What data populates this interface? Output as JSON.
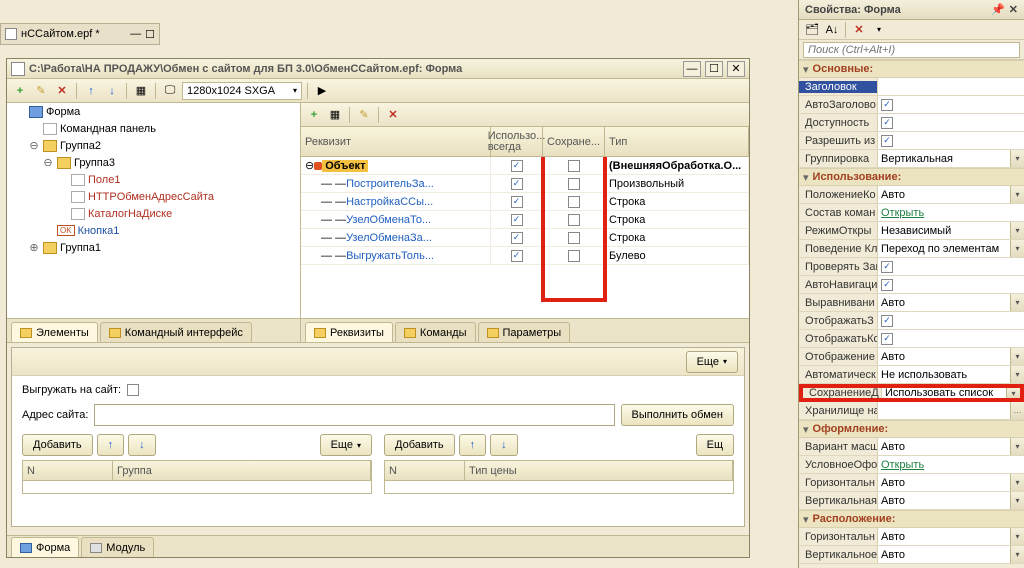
{
  "bg_tab": {
    "title": "нССайтом.epf *"
  },
  "window": {
    "title": "С:\\Работа\\НА ПРОДАЖУ\\Обмен с сайтом для БП 3.0\\ОбменССайтом.epf: Форма",
    "resolution": "1280x1024 SXGA"
  },
  "tree": {
    "items": [
      {
        "label": "Форма",
        "icon": "form",
        "indent": 0,
        "tw": ""
      },
      {
        "label": "Командная панель",
        "icon": "item",
        "indent": 1,
        "tw": ""
      },
      {
        "label": "Группа2",
        "icon": "folder",
        "indent": 1,
        "tw": "⊖"
      },
      {
        "label": "Группа3",
        "icon": "folder",
        "indent": 2,
        "tw": "⊖"
      },
      {
        "label": "Поле1",
        "icon": "item",
        "indent": 3,
        "tw": "",
        "red": true
      },
      {
        "label": "HTTPОбменАдресСайта",
        "icon": "item",
        "indent": 3,
        "tw": "",
        "red": true
      },
      {
        "label": "КаталогНаДиске",
        "icon": "item",
        "indent": 3,
        "tw": "",
        "red": true
      },
      {
        "label": "Кнопка1",
        "icon": "item",
        "indent": 2,
        "tw": "",
        "blue": true,
        "ok": true
      },
      {
        "label": "Группа1",
        "icon": "folder",
        "indent": 1,
        "tw": "⊕"
      }
    ]
  },
  "left_tabs": [
    "Элементы",
    "Командный интерфейс"
  ],
  "grid": {
    "headers": {
      "c1": "Реквизит",
      "c2": "Использо...\nвсегда",
      "c3": "Сохране...",
      "c4": "Тип"
    },
    "rows": [
      {
        "name": "Объект",
        "use": true,
        "save": false,
        "type": "(ВнешняяОбработка.О...",
        "bold": true,
        "tw": "⊖"
      },
      {
        "name": "ПостроительЗа...",
        "use": true,
        "save": false,
        "type": "Произвольный",
        "tw": ""
      },
      {
        "name": "НастройкаССы...",
        "use": true,
        "save": false,
        "type": "Строка",
        "tw": ""
      },
      {
        "name": "УзелОбменаТо...",
        "use": true,
        "save": false,
        "type": "Строка",
        "tw": ""
      },
      {
        "name": "УзелОбменаЗа...",
        "use": true,
        "save": false,
        "type": "Строка",
        "tw": ""
      },
      {
        "name": "ВыгружатьТоль...",
        "use": true,
        "save": false,
        "type": "Булево",
        "tw": ""
      }
    ]
  },
  "right_tabs": [
    "Реквизиты",
    "Команды",
    "Параметры"
  ],
  "preview": {
    "more": "Еще",
    "upload_label": "Выгружать на сайт:",
    "address_label": "Адрес сайта:",
    "exchange_btn": "Выполнить обмен",
    "add_btn": "Добавить",
    "tbl_n": "N",
    "tbl_group": "Группа",
    "tbl_price": "Тип цены",
    "more2": "Ещ"
  },
  "module_tabs": [
    "Форма",
    "Модуль"
  ],
  "props": {
    "title": "Свойства: Форма",
    "search_ph": "Поиск (Ctrl+Alt+I)",
    "categories": [
      {
        "name": "Основные:",
        "rows": [
          {
            "label": "Заголовок",
            "type": "text",
            "value": "",
            "hl": true
          },
          {
            "label": "АвтоЗаголово",
            "type": "check",
            "value": true
          },
          {
            "label": "Доступность",
            "type": "check",
            "value": true
          },
          {
            "label": "Разрешить из",
            "type": "check",
            "value": true
          },
          {
            "label": "Группировка",
            "type": "combo",
            "value": "Вертикальная"
          }
        ]
      },
      {
        "name": "Использование:",
        "rows": [
          {
            "label": "ПоложениеКо",
            "type": "combo",
            "value": "Авто"
          },
          {
            "label": "Состав коман",
            "type": "link",
            "value": "Открыть"
          },
          {
            "label": "РежимОткры",
            "type": "combo",
            "value": "Независимый"
          },
          {
            "label": "Поведение Кл",
            "type": "combo",
            "value": "Переход по элементам"
          },
          {
            "label": "Проверять Заг",
            "type": "check",
            "value": true
          },
          {
            "label": "АвтоНавигаци",
            "type": "check",
            "value": true
          },
          {
            "label": "Выравнивани",
            "type": "combo",
            "value": "Авто"
          },
          {
            "label": "ОтображатьЗ",
            "type": "check",
            "value": true
          },
          {
            "label": "ОтображатьКо",
            "type": "check",
            "value": true
          },
          {
            "label": "Отображение",
            "type": "combo",
            "value": "Авто"
          }
        ]
      },
      {
        "name": "",
        "rows": [
          {
            "label": "Автоматическ",
            "type": "combo",
            "value": "Не использовать"
          },
          {
            "label": "СохранениеД",
            "type": "combo",
            "value": "Использовать список",
            "big_hl": true
          },
          {
            "label": "Хранилище на",
            "type": "ellipsis",
            "value": ""
          }
        ]
      },
      {
        "name": "Оформление:",
        "rows": [
          {
            "label": "Вариант масш",
            "type": "combo",
            "value": "Авто"
          },
          {
            "label": "УсловноеОфо",
            "type": "link",
            "value": "Открыть"
          },
          {
            "label": "Горизонтальн",
            "type": "combo",
            "value": "Авто"
          },
          {
            "label": "Вертикальная",
            "type": "combo",
            "value": "Авто"
          }
        ]
      },
      {
        "name": "Расположение:",
        "rows": [
          {
            "label": "Горизонтальн",
            "type": "combo",
            "value": "Авто"
          },
          {
            "label": "Вертикальное",
            "type": "combo",
            "value": "Авто"
          }
        ]
      }
    ]
  }
}
